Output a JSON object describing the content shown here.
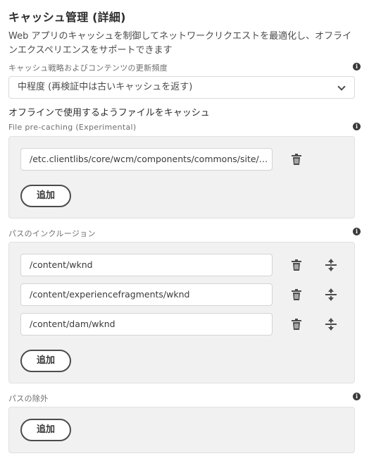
{
  "header": {
    "title": "キャッシュ管理 (詳細)",
    "description": "Web アプリのキャッシュを制御してネットワークリクエストを最適化し、オフラインエクスペリエンスをサポートできます"
  },
  "cache_strategy": {
    "label": "キャッシュ戦略およびコンテンツの更新頻度",
    "selected": "中程度 (再検証中は古いキャッシュを返す)"
  },
  "offline": {
    "heading": "オフラインで使用するようファイルをキャッシュ"
  },
  "precaching": {
    "label": "File pre-caching (Experimental)",
    "items": [
      "/etc.clientlibs/core/wcm/components/commons/site/cli..."
    ],
    "add_label": "追加"
  },
  "inclusions": {
    "label": "パスのインクルージョン",
    "items": [
      "/content/wknd",
      "/content/experiencefragments/wknd",
      "/content/dam/wknd"
    ],
    "add_label": "追加"
  },
  "exclusions": {
    "label": "パスの除外",
    "add_label": "追加"
  },
  "icons": {
    "info": "info-icon",
    "delete": "trash-icon",
    "reorder": "drag-handle-icon",
    "dropdown": "chevron-down-icon"
  },
  "colors": {
    "panel_bg": "#f1f1f1",
    "text": "#2c2c2c",
    "icon": "#4b4b4b"
  }
}
